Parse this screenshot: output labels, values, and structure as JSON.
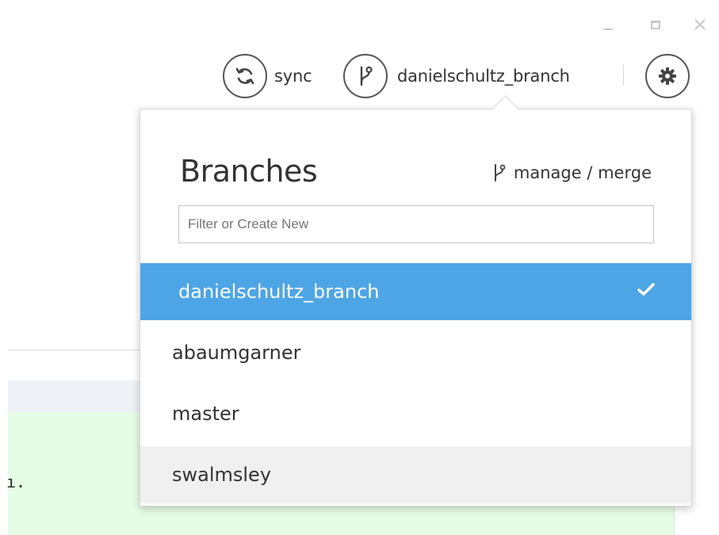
{
  "toolbar": {
    "sync_label": "sync",
    "current_branch": "danielschultz_branch"
  },
  "flyout": {
    "title": "Branches",
    "manage_label": "manage / merge",
    "filter_placeholder": "Filter or Create New",
    "branches": [
      {
        "name": "danielschultz_branch",
        "selected": true
      },
      {
        "name": "abaumgarner",
        "selected": false
      },
      {
        "name": "master",
        "selected": false
      },
      {
        "name": "swalmsley",
        "selected": false,
        "hovered": true
      }
    ]
  },
  "background": {
    "snippet": "ı."
  },
  "colors": {
    "selected_row": "#4ea5e6",
    "hover_row": "#f0f0f0",
    "accent_text": "#333333",
    "diff_added": "#e6fde5"
  },
  "icons": {
    "sync": "sync-icon",
    "branch": "branch-icon",
    "settings": "gear-icon",
    "check": "check-icon"
  }
}
